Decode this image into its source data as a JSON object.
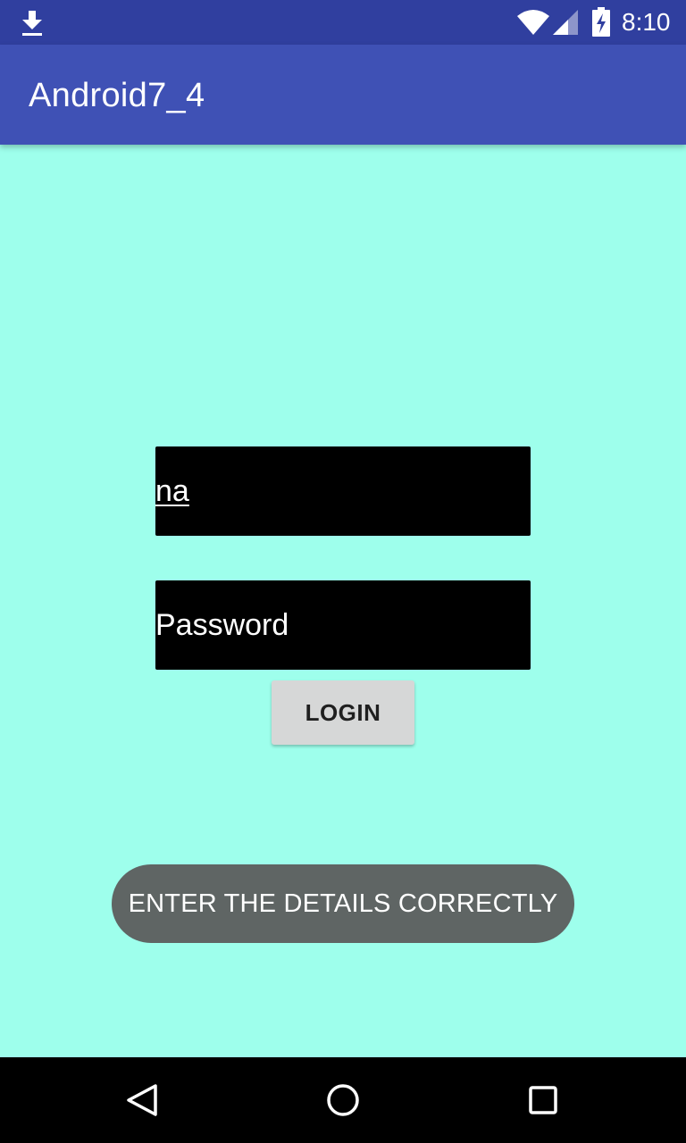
{
  "status_bar": {
    "time": "8:10",
    "icons": [
      "download-icon",
      "wifi-icon",
      "signal-icon",
      "battery-charging-icon"
    ]
  },
  "app_bar": {
    "title": "Android7_4"
  },
  "form": {
    "username_value": "na",
    "password_placeholder": "Password",
    "login_label": "LOGIN"
  },
  "toast": {
    "message": "ENTER THE DETAILS CORRECTLY"
  },
  "nav_bar": {
    "icons": [
      "back-icon",
      "home-icon",
      "recents-icon"
    ]
  },
  "colors": {
    "status_bar": "#303f9f",
    "app_bar": "#3f51b5",
    "background": "#9effec",
    "field_background": "#000000",
    "button": "#d6d7d7",
    "toast": "#5f6564"
  }
}
